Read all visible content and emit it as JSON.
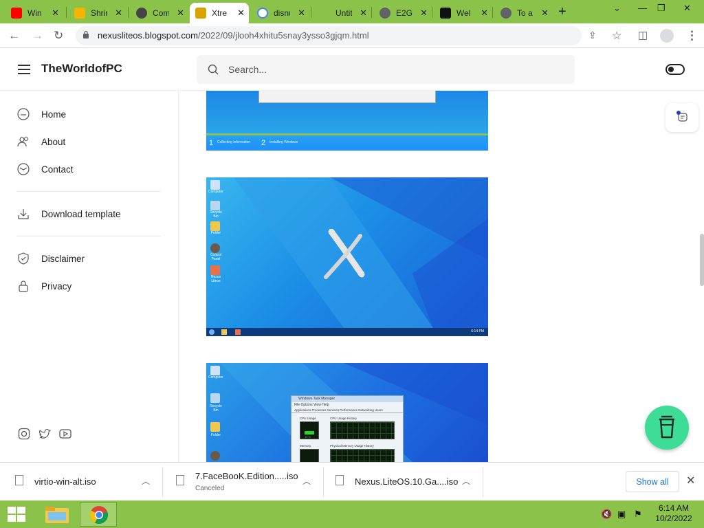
{
  "browser": {
    "tabs": [
      {
        "label": "Win",
        "icon": "youtube-icon",
        "color": "#ff0000"
      },
      {
        "label": "Shrir",
        "icon": "sparkle-icon",
        "color": "#f4b400"
      },
      {
        "label": "Com",
        "icon": "ghost-icon",
        "color": "#444444"
      },
      {
        "label": "Xtre",
        "icon": "site-icon",
        "color": "#d9a400",
        "active": true
      },
      {
        "label": "disnu",
        "icon": "google-icon",
        "color": "#4285f4"
      },
      {
        "label": "Untit",
        "icon": "blank-icon",
        "color": "#8bc34a"
      },
      {
        "label": "E2GI",
        "icon": "globe-icon",
        "color": "#5f6368"
      },
      {
        "label": "Wel",
        "icon": "logo-icon",
        "color": "#111111"
      },
      {
        "label": "To a",
        "icon": "globe-icon",
        "color": "#5f6368"
      }
    ],
    "url_host": "nexusliteos.blogspot.com",
    "url_path": "/2022/09/jlooh4xhitu5snay3ysso3gjqm.html"
  },
  "site": {
    "title": "TheWorldofPC",
    "search_placeholder": "Search..."
  },
  "sidebar": {
    "items": [
      {
        "label": "Home",
        "icon": "home-icon"
      },
      {
        "label": "About",
        "icon": "users-icon"
      },
      {
        "label": "Contact",
        "icon": "mail-icon"
      },
      {
        "label": "Download template",
        "icon": "download-icon"
      },
      {
        "label": "Disclaimer",
        "icon": "shield-icon"
      },
      {
        "label": "Privacy",
        "icon": "lock-icon"
      }
    ],
    "social": [
      "instagram-icon",
      "twitter-icon",
      "youtube-icon"
    ]
  },
  "content": {
    "shot1_steps": [
      "1",
      "Collecting information",
      "2",
      "Installing Windows"
    ],
    "shot2_icons": [
      "Computer",
      "Recycle Bin",
      "Folder",
      "Control Panel",
      "Nexus Liteos"
    ],
    "shot2_clock": "6:14 PM",
    "shot3_icons": [
      "Computer",
      "Recycle Bin",
      "Folder"
    ],
    "taskmgr_title": "Windows Task Manager",
    "taskmgr_menu": "File   Options   View   Help",
    "taskmgr_tabs": "Applications  Processes  Services  Performance  Networking  Users",
    "taskmgr_cpu": "CPU Usage",
    "taskmgr_cpu_hist": "CPU Usage History",
    "taskmgr_cpu_val": "15 %",
    "taskmgr_mem": "Memory",
    "taskmgr_mem_hist": "Physical Memory Usage History"
  },
  "downloads": [
    {
      "name": "virtio-win-alt.iso",
      "status": ""
    },
    {
      "name": "7.FaceBooK.Edition.....iso",
      "status": "Canceled"
    },
    {
      "name": "Nexus.LiteOS.10.Ga....iso",
      "status": ""
    }
  ],
  "downloads_show_all": "Show all",
  "taskbar": {
    "time": "6:14 AM",
    "date": "10/2/2022"
  }
}
